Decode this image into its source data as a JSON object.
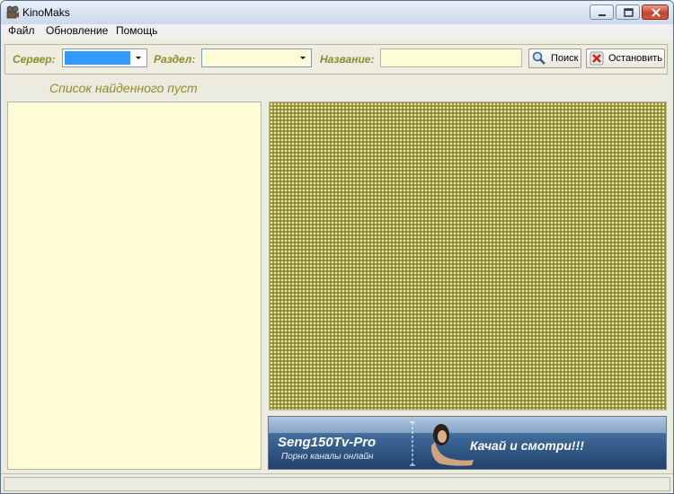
{
  "window": {
    "title": "KinoMaks"
  },
  "menu": {
    "items": [
      {
        "label": "Файл"
      },
      {
        "label": "Обновление"
      },
      {
        "label": "Помощь"
      }
    ]
  },
  "toolbar": {
    "server_label": "Сервер:",
    "server_value": "",
    "section_label": "Раздел:",
    "section_value": "",
    "name_label": "Название:",
    "name_value": "",
    "search_button": "Поиск",
    "stop_button": "Остановить"
  },
  "results": {
    "heading": "Список найденного пуст"
  },
  "banner": {
    "title": "Seng150Tv-Pro",
    "subtitle": "Порно каналы онлайн",
    "slogan": "Качай и смотри!!!"
  },
  "status": {
    "text": ""
  },
  "colors": {
    "label_accent": "#8c8c2a",
    "field_background": "#fffcd8",
    "server_selection": "#3399ff",
    "preview_pattern": "#8f8d2a"
  }
}
